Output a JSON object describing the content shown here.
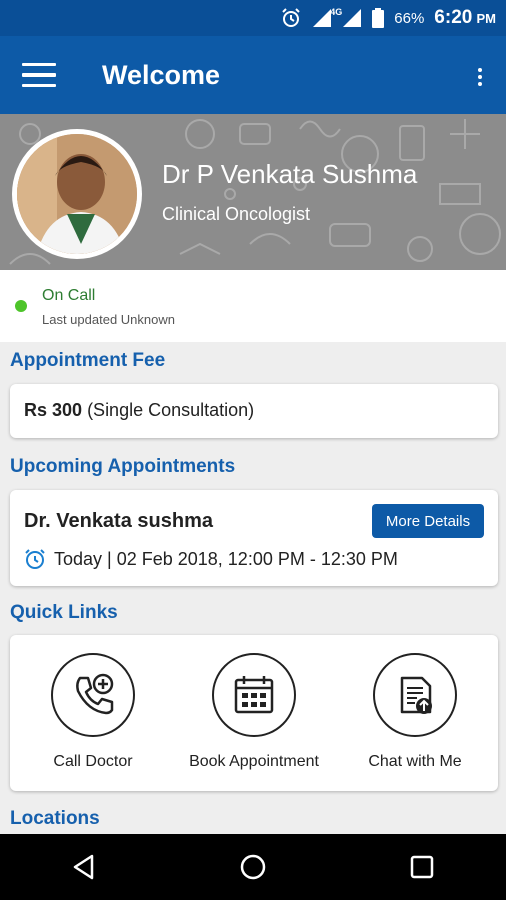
{
  "status_bar": {
    "battery": "66%",
    "time": "6:20",
    "ampm": "PM",
    "network": "4G"
  },
  "app_bar": {
    "title": "Welcome"
  },
  "doctor": {
    "name": "Dr P Venkata Sushma",
    "specialty": "Clinical Oncologist"
  },
  "availability": {
    "status": "On Call",
    "last_updated": "Last updated Unknown",
    "status_color": "#4dc42a"
  },
  "fee": {
    "section_title": "Appointment Fee",
    "amount": "Rs 300",
    "note": "(Single Consultation)"
  },
  "appointments": {
    "section_title": "Upcoming Appointments",
    "doctor": "Dr. Venkata sushma",
    "button": "More Details",
    "time": "Today | 02 Feb 2018, 12:00 PM - 12:30 PM"
  },
  "quick_links": {
    "section_title": "Quick Links",
    "items": [
      {
        "label": "Call Doctor",
        "icon": "phone-plus-icon"
      },
      {
        "label": "Book Appointment",
        "icon": "calendar-icon"
      },
      {
        "label": "Chat with Me",
        "icon": "document-upload-icon"
      }
    ]
  },
  "locations": {
    "section_title": "Locations"
  },
  "colors": {
    "primary": "#0d5aa7",
    "section_title": "#1660ad",
    "status_bar": "#0a4f97"
  }
}
